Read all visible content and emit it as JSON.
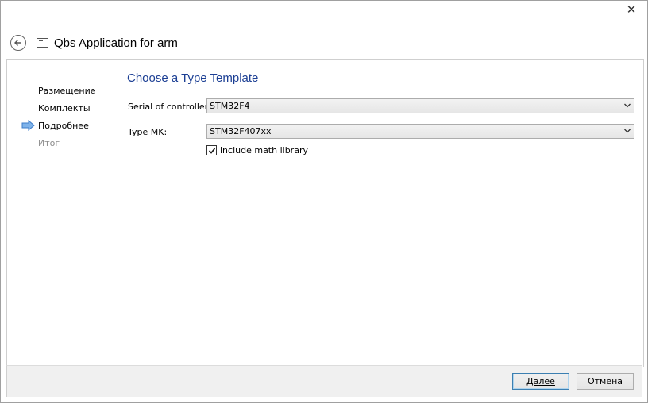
{
  "window": {
    "title": "Qbs Application for arm",
    "close_glyph": "✕"
  },
  "sidebar": {
    "items": [
      {
        "label": "Размещение",
        "state": "done"
      },
      {
        "label": "Комплекты",
        "state": "done"
      },
      {
        "label": "Подробнее",
        "state": "current"
      },
      {
        "label": "Итог",
        "state": "disabled"
      }
    ],
    "current_arrow_color": "#4a90d9"
  },
  "page": {
    "heading": "Choose a Type Template",
    "fields": {
      "serial_label": "Serial of controllers",
      "serial_value": "STM32F4",
      "type_label": "Type MK:",
      "type_value": "STM32F407xx",
      "math_label": "include math library",
      "math_checked": true
    }
  },
  "footer": {
    "next_label": "Далее",
    "cancel_label": "Отмена"
  },
  "colors": {
    "heading": "#1c3f94",
    "default_button_border": "#3c7fb1"
  }
}
